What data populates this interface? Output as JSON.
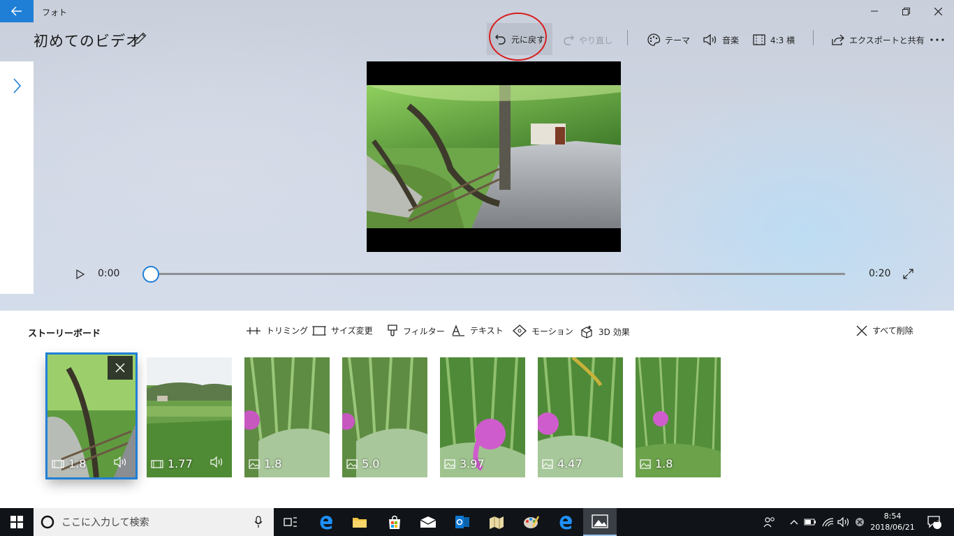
{
  "window": {
    "app_title": "フォト",
    "doc_title": "初めてのビデオ"
  },
  "toolbar": {
    "undo": "元に戻す",
    "redo": "やり直し",
    "theme": "テーマ",
    "music": "音楽",
    "aspect": "4:3 横",
    "export": "エクスポートと共有"
  },
  "player": {
    "current_time": "0:00",
    "duration": "0:20",
    "progress": 0
  },
  "storyboard": {
    "title": "ストーリーボード",
    "tools": {
      "trim": "トリミング",
      "resize": "サイズ変更",
      "filter": "フィルター",
      "text": "テキスト",
      "motion": "モーション",
      "effects3d": "3D 効果",
      "remove_all": "すべて削除"
    },
    "clips": [
      {
        "kind": "video",
        "duration": "1.8",
        "audio": true,
        "selected": true
      },
      {
        "kind": "video",
        "duration": "1.77",
        "audio": true,
        "selected": false
      },
      {
        "kind": "image",
        "duration": "1.8",
        "audio": false,
        "selected": false
      },
      {
        "kind": "image",
        "duration": "5.0",
        "audio": false,
        "selected": false
      },
      {
        "kind": "image",
        "duration": "3.97",
        "audio": false,
        "selected": false
      },
      {
        "kind": "image",
        "duration": "4.47",
        "audio": false,
        "selected": false
      },
      {
        "kind": "image",
        "duration": "1.8",
        "audio": false,
        "selected": false
      }
    ]
  },
  "taskbar": {
    "search_placeholder": "ここに入力して検索",
    "time": "8:54",
    "date": "2018/06/21",
    "notifications": "2"
  },
  "colors": {
    "accent": "#1f7fd6",
    "highlight_circle": "#d81e1e",
    "taskbar": "#101418"
  }
}
